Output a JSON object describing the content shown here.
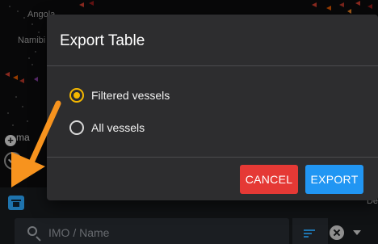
{
  "map": {
    "place_labels": {
      "angola": "Angola",
      "namibia": "Namibi",
      "partial": "ma"
    },
    "edge_text": "s\"",
    "right_text": "De"
  },
  "dialog": {
    "title": "Export Table",
    "options": [
      {
        "label": "Filtered vessels",
        "checked": true
      },
      {
        "label": "All vessels",
        "checked": false
      }
    ],
    "cancel_label": "CANCEL",
    "export_label": "EXPORT"
  },
  "search": {
    "placeholder": "IMO / Name"
  },
  "colors": {
    "accent_radio": "#f5b800",
    "cancel": "#e53935",
    "export": "#2196f3",
    "annotation_arrow": "#f7931e"
  },
  "icons": {
    "export_table": "export-table-icon",
    "search": "search-icon",
    "filter": "filter-icon",
    "clear": "clear-icon",
    "dropdown": "chevron-down-icon",
    "zoom": "zoom-in-icon",
    "compass": "compass-icon"
  }
}
